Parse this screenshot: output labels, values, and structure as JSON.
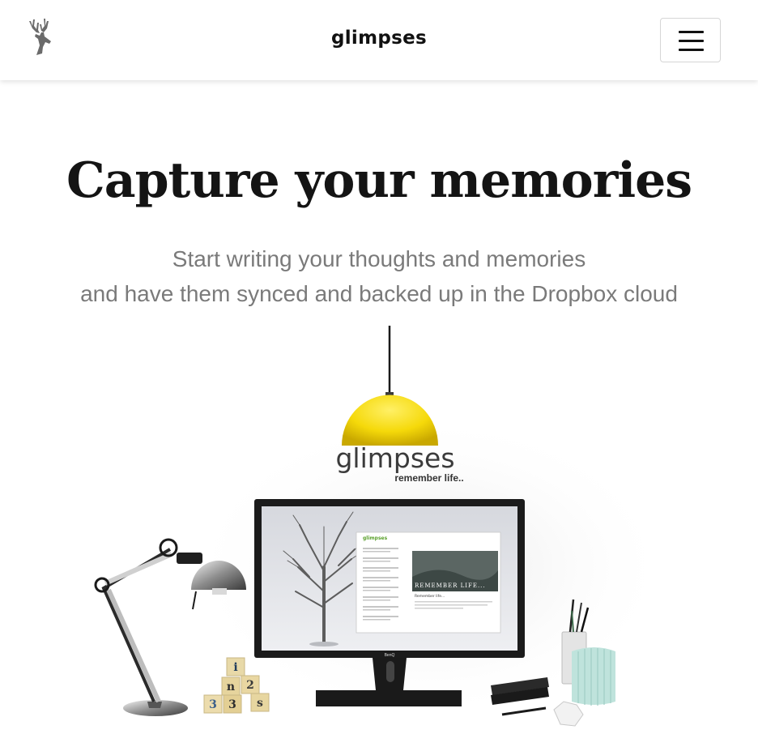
{
  "navbar": {
    "logo_icon": "deer-head-icon",
    "brand": "glimpses",
    "menu_icon": "hamburger-menu-icon"
  },
  "hero": {
    "title": "Capture your memories",
    "subtitle_line1": "Start writing your thoughts and memories",
    "subtitle_line2": "and have them synced and backed up in the Dropbox cloud"
  },
  "illustration": {
    "brand": "glimpses",
    "tagline": "remember life..",
    "monitor_label": "BenQ",
    "screen_banner": "REMEMBER LIFE...",
    "app_title": "glimpses",
    "entry_title": "Remember life...",
    "blocks": [
      "i",
      "n",
      "2",
      "3",
      "3",
      "s"
    ],
    "lamp_color": "#f5d90a"
  }
}
